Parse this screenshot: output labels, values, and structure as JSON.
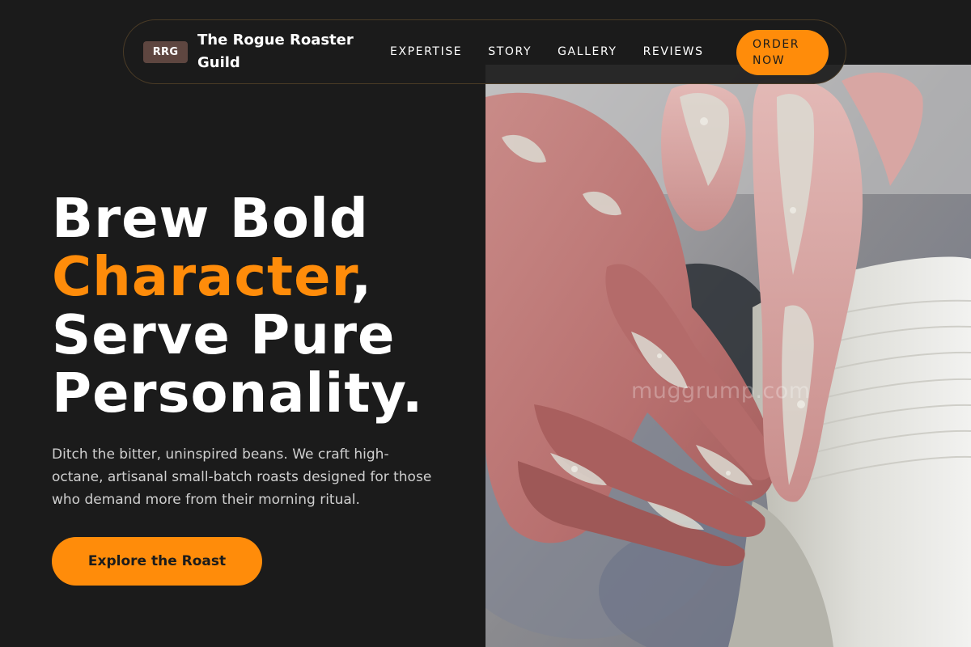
{
  "brand": {
    "badge": "RRG",
    "name": "The Rogue Roaster Guild"
  },
  "nav": {
    "links": [
      "EXPERTISE",
      "STORY",
      "GALLERY",
      "REVIEWS"
    ],
    "order_label": "ORDER NOW"
  },
  "hero": {
    "headline_line1": "Brew Bold",
    "headline_accent": "Character",
    "headline_comma": ",",
    "headline_line3": "Serve Pure",
    "headline_line4": "Personality.",
    "description": "Ditch the bitter, uninspired beans. We craft high-octane, artisanal small-batch roasts designed for those who demand more from their morning ritual.",
    "cta_label": "Explore the Roast",
    "image_watermark": "muggrump.com"
  },
  "colors": {
    "background": "#1b1b1b",
    "accent": "#ff8c0a",
    "badge": "#5e4640",
    "text": "#ffffff",
    "muted_text": "#cfcfcf"
  }
}
